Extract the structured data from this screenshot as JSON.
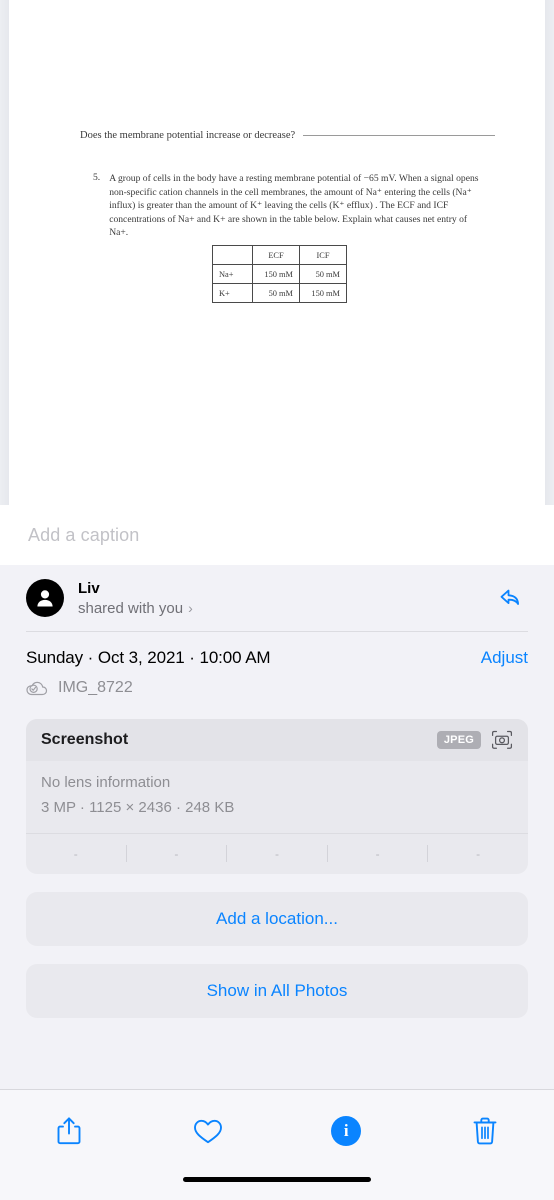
{
  "photo": {
    "document": {
      "question_prompt": "Does the membrane potential increase or decrease?",
      "item_number": "5.",
      "item_text_line1": "A group of cells in the body have a resting membrane potential of −65 mV.  When a signal",
      "item_text_line2": "opens non-specific cation channels in the cell membranes, the amount of Na⁺ entering the",
      "item_text_line3": "cells (Na⁺ influx) is greater than the amount of K⁺ leaving the cells (K⁺ efflux) . The ECF and",
      "item_text_line4": "ICF concentrations of Na+ and K+ are shown in the table below. Explain what causes net",
      "item_text_line5": "entry of Na+.",
      "table": {
        "corner": "",
        "columns": [
          "ECF",
          "ICF"
        ],
        "rows": [
          {
            "label": "Na+",
            "values": [
              "150 mM",
              "50 mM"
            ]
          },
          {
            "label": "K+",
            "values": [
              "50 mM",
              "150 mM"
            ]
          }
        ]
      }
    }
  },
  "caption": {
    "placeholder": "Add a caption"
  },
  "shared": {
    "name": "Liv",
    "subtitle": "shared with you",
    "chevron": "›",
    "reply_icon": "reply-arrow-icon"
  },
  "date": {
    "text": "Sunday · Oct 3, 2021 · 10:00 AM",
    "adjust_label": "Adjust",
    "file_name": "IMG_8722",
    "cloud_icon": "cloud-check-icon"
  },
  "metadata": {
    "title": "Screenshot",
    "format_badge": "JPEG",
    "camera_icon": "camera-icon",
    "lens_info": "No lens information",
    "specs": "3 MP  ·  1125 × 2436  ·  248 KB",
    "exif": [
      "-",
      "-",
      "-",
      "-",
      "-"
    ]
  },
  "actions": {
    "add_location": "Add a location...",
    "show_in_all_photos": "Show in All Photos"
  },
  "toolbar": {
    "share": "share-icon",
    "favorite": "heart-icon",
    "info": "info-icon",
    "info_glyph": "i",
    "delete": "trash-icon"
  },
  "colors": {
    "accent": "#0a84ff",
    "sheet_bg": "#f2f2f7",
    "card_bg": "#e9e9ee",
    "secondary_text": "#8e8e93"
  }
}
